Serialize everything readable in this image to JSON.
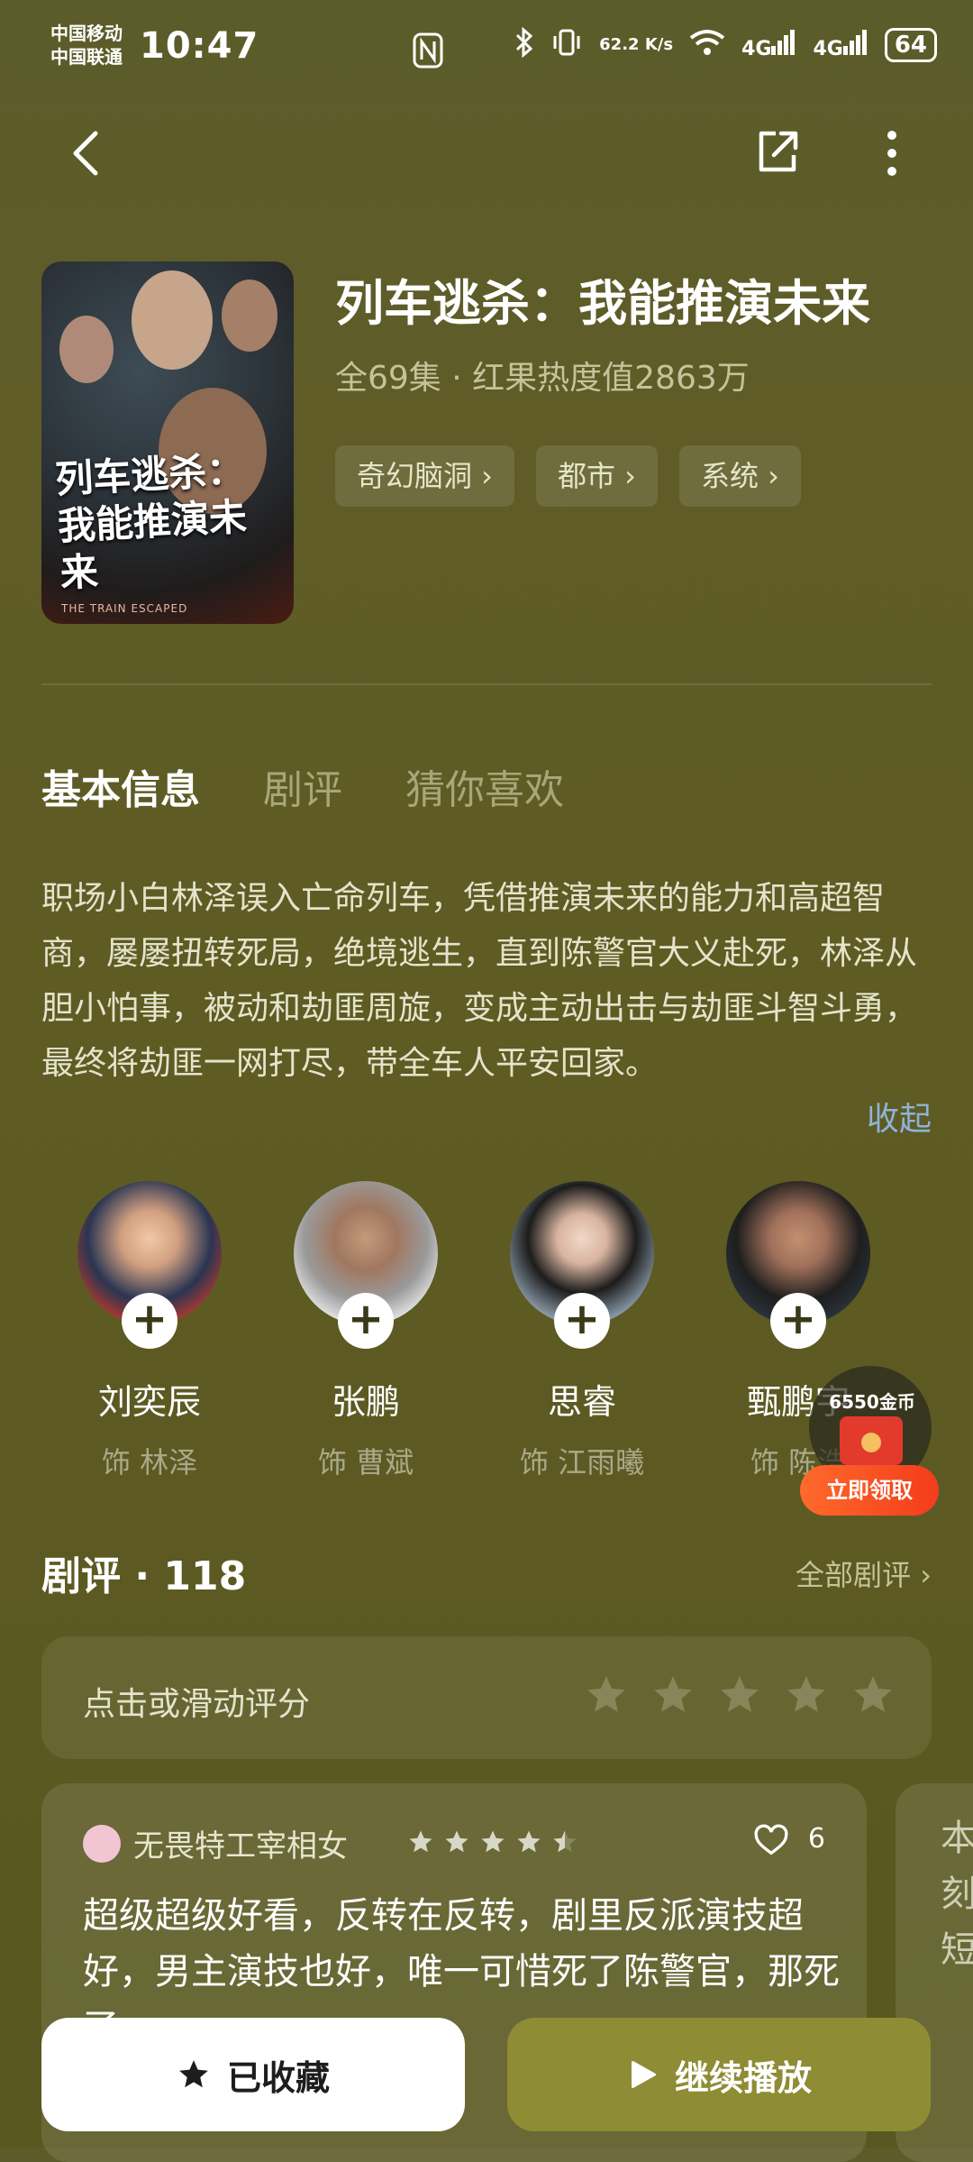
{
  "status_bar": {
    "carrier1": "中国移动",
    "carrier2": "中国联通",
    "time": "10:47",
    "nfc_icon": "N",
    "speed": "62.2 K/s",
    "net1": "4G",
    "net2": "4G",
    "battery": "64"
  },
  "header": {
    "back_icon": "chevron-left-icon",
    "share_icon": "share-icon",
    "more_icon": "more-vertical-icon"
  },
  "show": {
    "poster_title": "列车逃杀：我能推演未来",
    "poster_subtitle": "THE TRAIN ESCAPED",
    "title": "列车逃杀：我能推演未来",
    "meta": "全69集 · 红果热度值2863万",
    "tags": [
      "奇幻脑洞 ›",
      "都市 ›",
      "系统 ›"
    ]
  },
  "tabs": [
    "基本信息",
    "剧评",
    "猜你喜欢"
  ],
  "synopsis": "职场小白林泽误入亡命列车，凭借推演未来的能力和高超智商，屡屡扭转死局，绝境逃生，直到陈警官大义赴死，林泽从胆小怕事，被动和劫匪周旋，变成主动出击与劫匪斗智斗勇，最终将劫匪一网打尽，带全车人平安回家。",
  "collapse_label": "收起",
  "cast": [
    {
      "name": "刘奕辰",
      "role": "饰 林泽",
      "color": "#c0392b"
    },
    {
      "name": "张鹏",
      "role": "饰 曹斌",
      "color": "#e8e8e8"
    },
    {
      "name": "思睿",
      "role": "饰 江雨曦",
      "color": "#8a9aa8"
    },
    {
      "name": "甄鹏宇",
      "role": "饰 陈浩",
      "color": "#2c3640"
    }
  ],
  "coin_widget": {
    "amount": "6550金币",
    "button": "立即领取"
  },
  "reviews": {
    "title": "剧评 · 118",
    "all_label": "全部剧评 ›",
    "rate_prompt": "点击或滑动评分",
    "items": [
      {
        "user": "无畏特工宰相女",
        "rating": 4.5,
        "likes": "6",
        "text": "超级超级好看，反转在反转，剧里反派演技超好，男主演技也好，唯一可惜死了陈警官，那死了"
      }
    ],
    "peek_text": "本刻短"
  },
  "actions": {
    "favorite": "已收藏",
    "play": "继续播放"
  },
  "colors": {
    "background": "#5e5b24",
    "accent_play": "#8e8c34",
    "link": "#8fb3d9"
  }
}
